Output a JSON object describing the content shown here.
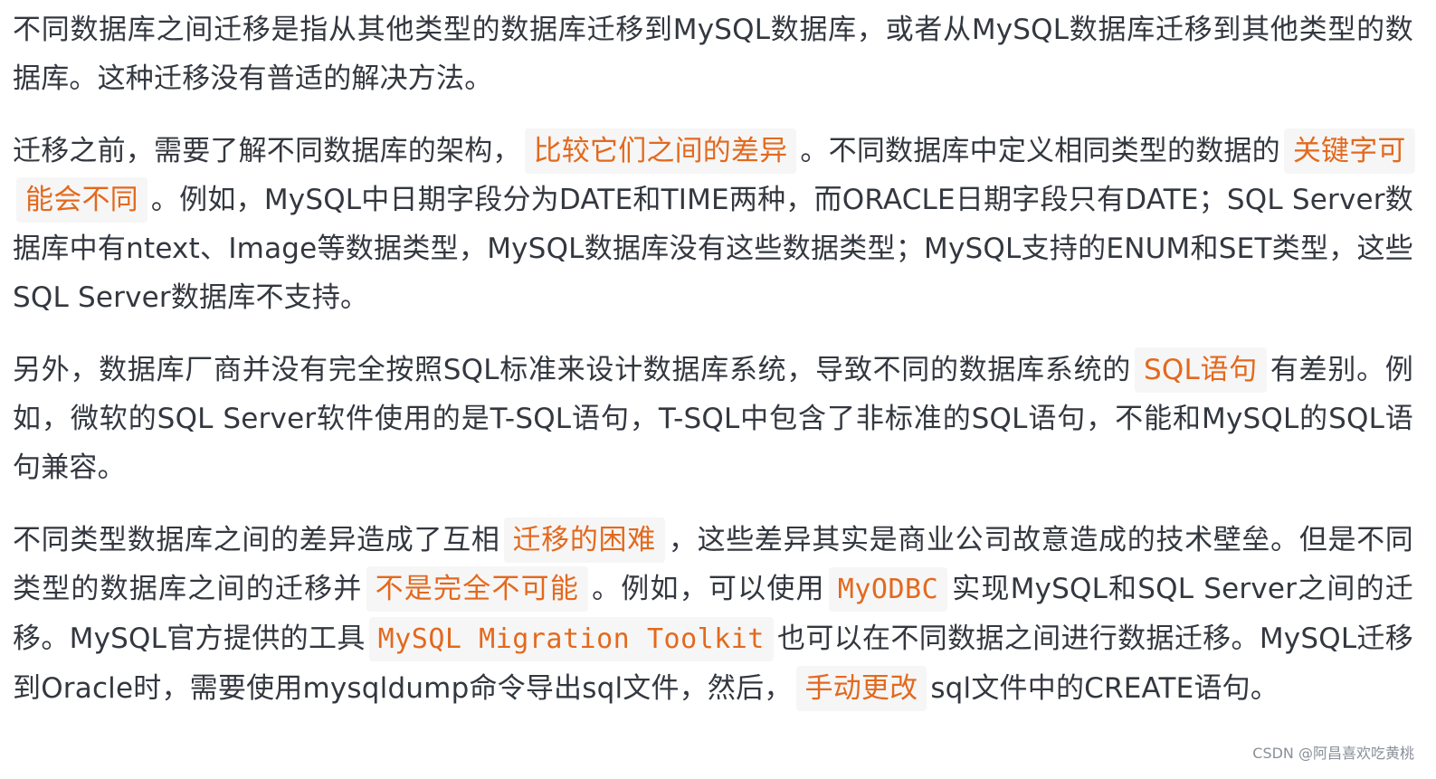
{
  "paragraphs": [
    {
      "segments": [
        {
          "text": "不同数据库之间迁移是指从其他类型的数据库迁移到MySQL数据库，或者从MySQL数据库迁移到其他类型的数据库。这种迁移没有普适的解决方法。"
        }
      ]
    },
    {
      "segments": [
        {
          "text": "迁移之前，需要了解不同数据库的架构，"
        },
        {
          "text": "比较它们之间的差异",
          "highlight": true
        },
        {
          "text": "。不同数据库中定义相同类型的数据的"
        },
        {
          "text": "关键字可能会不同",
          "highlight": true
        },
        {
          "text": "。例如，MySQL中日期字段分为DATE和TIME两种，而ORACLE日期字段只有DATE；SQL Server数据库中有ntext、Image等数据类型，MySQL数据库没有这些数据类型；MySQL支持的ENUM和SET类型，这些SQL Server数据库不支持。"
        }
      ]
    },
    {
      "segments": [
        {
          "text": "另外，数据库厂商并没有完全按照SQL标准来设计数据库系统，导致不同的数据库系统的"
        },
        {
          "text": "SQL语句",
          "highlight": true
        },
        {
          "text": "有差别。例如，微软的SQL Server软件使用的是T-SQL语句，T-SQL中包含了非标准的SQL语句，不能和MySQL的SQL语句兼容。"
        }
      ]
    },
    {
      "segments": [
        {
          "text": "不同类型数据库之间的差异造成了互相"
        },
        {
          "text": "迁移的困难",
          "highlight": true
        },
        {
          "text": "，这些差异其实是商业公司故意造成的技术壁垒。但是不同类型的数据库之间的迁移并"
        },
        {
          "text": "不是完全不可能",
          "highlight": true
        },
        {
          "text": "。例如，可以使用"
        },
        {
          "text": "MyODBC",
          "highlight": true,
          "code": true
        },
        {
          "text": "实现MySQL和SQL Server之间的迁移。MySQL官方提供的工具"
        },
        {
          "text": "MySQL Migration Toolkit",
          "highlight": true,
          "code": true
        },
        {
          "text": "也可以在不同数据之间进行数据迁移。MySQL迁移到Oracle时，需要使用mysqldump命令导出sql文件，然后，"
        },
        {
          "text": "手动更改",
          "highlight": true
        },
        {
          "text": "sql文件中的CREATE语句。"
        }
      ]
    }
  ],
  "watermark": "CSDN @阿昌喜欢吃黄桃",
  "colors": {
    "text": "#33373f",
    "highlight_text": "#e3691e",
    "highlight_bg": "#f6f6f6",
    "watermark": "#8a8f98"
  }
}
